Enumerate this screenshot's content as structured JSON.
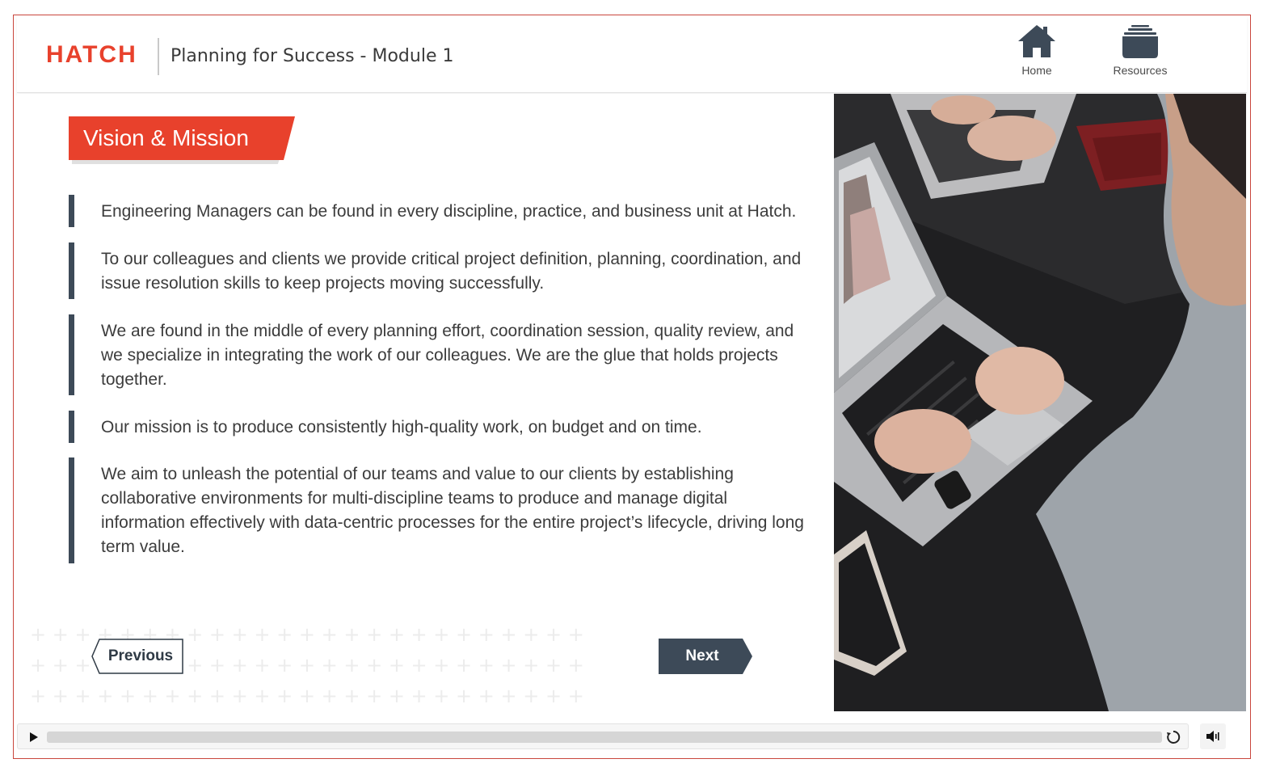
{
  "header": {
    "logo_text": "HATCH",
    "course_title": "Planning for Success - Module 1",
    "nav": {
      "home_label": "Home",
      "home_icon": "house-icon",
      "resources_label": "Resources",
      "resources_icon": "folder-stack-icon"
    }
  },
  "slide": {
    "title": "Vision & Mission",
    "paragraphs": [
      "Engineering Managers can be found in every discipline, practice, and business unit at Hatch.",
      "To our colleagues and clients we provide critical project definition, planning, coordination, and issue resolution skills to keep projects moving successfully.",
      "We are found in the middle of every planning effort, coordination session, quality review, and we specialize in integrating the work of our colleagues. We are the glue that holds projects together.",
      "Our mission is to produce consistently high-quality work, on budget and on time.",
      "We aim to unleash the potential of our teams and value to our clients by establishing collaborative environments for multi-discipline teams to produce and manage digital information effectively with data-centric processes for the entire project’s lifecycle, driving long term value."
    ],
    "previous_label": "Previous",
    "next_label": "Next"
  },
  "player": {
    "play_icon": "play-icon",
    "replay_icon": "replay-icon",
    "volume_icon": "volume-icon",
    "progress": 0.0
  },
  "colors": {
    "brand_red": "#e8412c",
    "slate": "#3d4a58",
    "frame_border": "#c9463d"
  }
}
